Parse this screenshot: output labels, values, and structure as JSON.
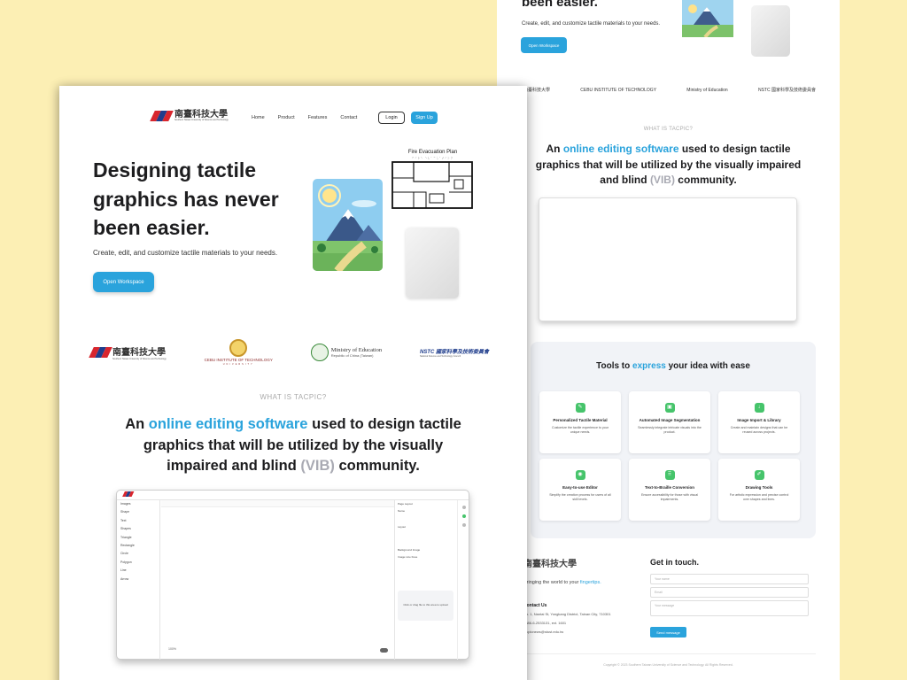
{
  "nav": {
    "logo_text": "南臺科技大學",
    "logo_sub": "Southern Taiwan University of Science and Technology",
    "links": [
      "Home",
      "Product",
      "Features",
      "Contact"
    ],
    "login": "Login",
    "signup": "Sign Up"
  },
  "hero": {
    "heading": "Designing tactile graphics has never been easier.",
    "subtitle": "Create, edit, and customize tactile materials to your needs.",
    "cta": "Open Workspace",
    "plan_title": "Fire Evacuation Plan"
  },
  "partners": [
    {
      "name": "南臺科技大學",
      "sub": "Southern Taiwan University of Science and Technology"
    },
    {
      "name": "CEBU INSTITUTE OF TECHNOLOGY",
      "sub": "UNIVERSITY"
    },
    {
      "name": "Ministry of Education",
      "sub": "Republic of China (Taiwan)"
    },
    {
      "name": "NSTC 國家科學及技術委員會",
      "sub": "National Science and Technology Council"
    }
  ],
  "about": {
    "kicker": "WHAT IS TACPIC?",
    "t1": "An ",
    "t2": "online editing software",
    "t3": " used to design tactile graphics that will be utilized by the visually impaired and blind ",
    "t4": "(VIB)",
    "t5": " community."
  },
  "app_preview": {
    "left_items": [
      "Images",
      "Shape",
      "Text",
      "Shapes",
      "Triangle",
      "Rectangle",
      "Circle",
      "Polygon",
      "Line",
      "Arrow"
    ],
    "right_items": [
      "Page Layout",
      "Name",
      "Layout",
      "Background Image",
      "Image Line Fuse"
    ],
    "upload_text": "Click or drag file to this area to upload",
    "zoom": "100%"
  },
  "back_header": {
    "heading": "been easier.",
    "subtitle": "Create, edit, and customize tactile materials to your needs.",
    "cta": "Open Workspace"
  },
  "tools": {
    "title_pre": "Tools to ",
    "title_hl": "express",
    "title_post": " your idea with ease",
    "cards": [
      {
        "name": "Personalized Tactile Material",
        "desc": "Customize the tactile experience to your unique needs."
      },
      {
        "name": "Automated Image Segmentation",
        "desc": "Seamlessly integrate intricate visuals into the product."
      },
      {
        "name": "Image Import & Library",
        "desc": "Create and maintain designs that can be reused across projects."
      },
      {
        "name": "Easy-to-use Editor",
        "desc": "Simplify the creation process for users of all skill levels."
      },
      {
        "name": "Text-to-Braille Conversion",
        "desc": "Ensure accessibility for those with visual impairments."
      },
      {
        "name": "Drawing Tools",
        "desc": "For artistic expression and precise control over shapes and lines."
      }
    ]
  },
  "contact": {
    "tagline_pre": "Bringing the world to your ",
    "tagline_hl": "fingertips.",
    "title": "Contact Us",
    "address": "No. 1, Nantai St, Yongkang District, Tainan City, 710301",
    "phone": "+886-6-2533131, ext. 1601",
    "email": "tacpicnews@stust.edu.tw",
    "get_in_touch": "Get in touch.",
    "name_placeholder": "Your name",
    "email_placeholder": "Email",
    "message_placeholder": "Your message",
    "send": "Send message",
    "copyright": "Copyright © 2023 Southern Taiwan University of Science and Technology. All Rights Reserved."
  },
  "colors": {
    "accent": "#2aa3dc",
    "background": "#fcefb4",
    "green": "#46c46b"
  }
}
